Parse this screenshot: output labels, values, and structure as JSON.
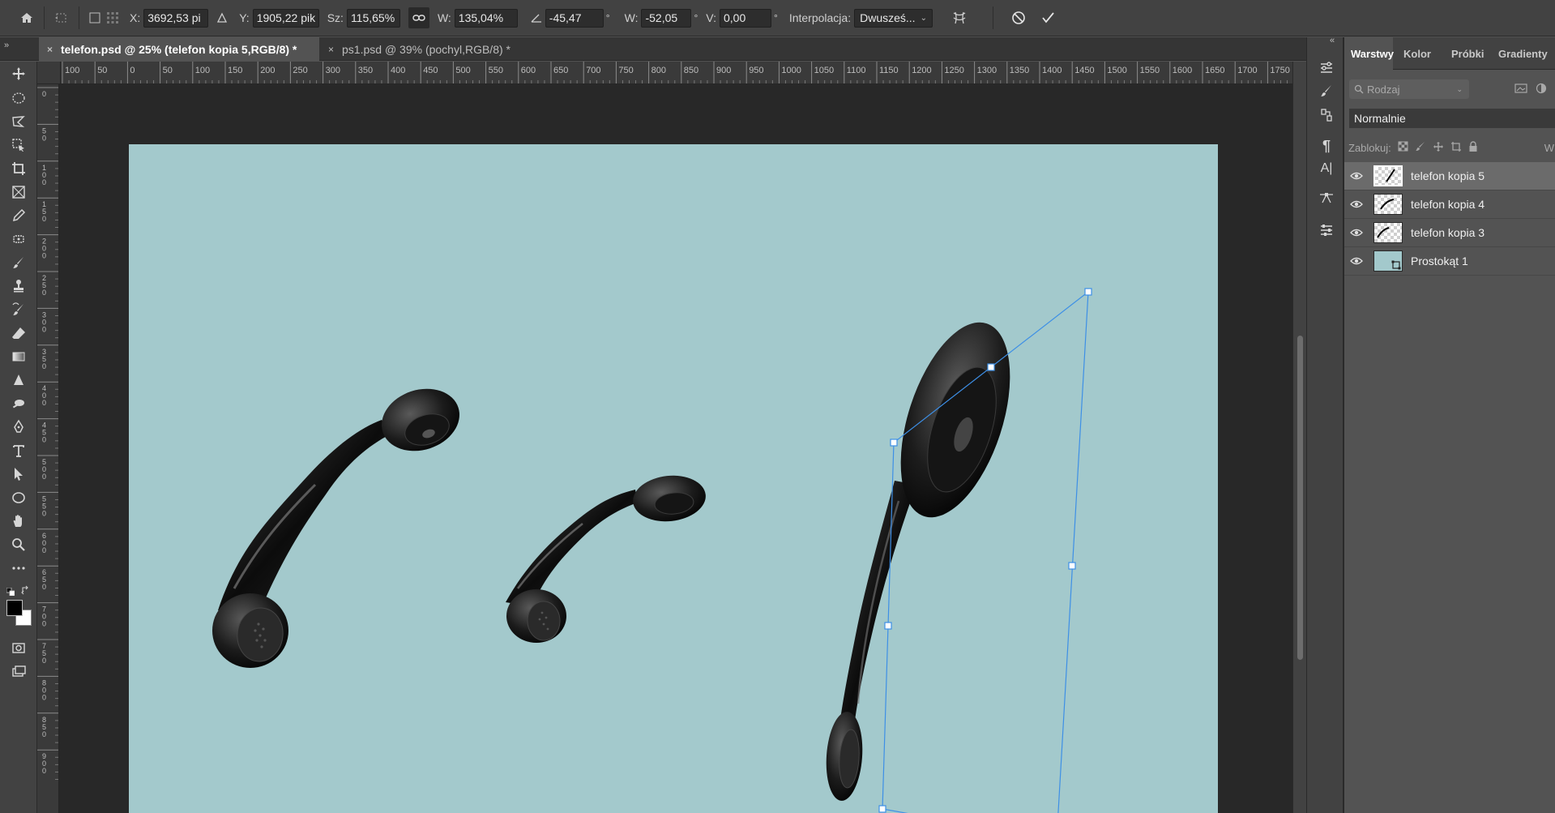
{
  "options_bar": {
    "icons": [
      "home-icon",
      "transform-reference-icon",
      "reference-point-checkbox",
      "reference-grid-icon"
    ],
    "x_label": "X:",
    "x_value": "3692,53 pi",
    "y_label": "Y:",
    "y_value": "1905,22 pik",
    "w_label": "Sz:",
    "w_value": "115,65%",
    "h_label": "W:",
    "h_value": "135,04%",
    "rotate_value": "-45,47",
    "degree_unit": "°",
    "skew_h_label": "W:",
    "skew_h_value": "-52,05",
    "skew_v_label": "V:",
    "skew_v_value": "0,00",
    "interpolation_label": "Interpolacja:",
    "interpolation_value": "Dwusześ..."
  },
  "tabs": [
    {
      "close": "×",
      "label": "telefon.psd @ 25% (telefon kopia 5,RGB/8) *",
      "active": true
    },
    {
      "close": "×",
      "label": "ps1.psd @ 39% (pochyl,RGB/8) *",
      "active": false
    }
  ],
  "rulers": {
    "top_ticks": [
      "100",
      "50",
      "0",
      "50",
      "100",
      "150",
      "200",
      "250",
      "300",
      "350",
      "400",
      "450",
      "500",
      "550",
      "600",
      "650",
      "700",
      "750",
      "800",
      "850",
      "900",
      "950",
      "1000",
      "1050",
      "1100",
      "1150",
      "1200",
      "1250",
      "1300",
      "1350",
      "1400",
      "1450",
      "1500",
      "1550",
      "1600",
      "1650",
      "1700",
      "1750"
    ],
    "left_ticks": [
      "0",
      "50",
      "100",
      "150",
      "200",
      "250",
      "300",
      "350",
      "400",
      "450",
      "500",
      "550",
      "600",
      "650",
      "700",
      "750",
      "800",
      "850",
      "900"
    ]
  },
  "canvas": {
    "background_color": "#a3c9cc",
    "handle_color": "#3d8fe6"
  },
  "layers_panel": {
    "tabs": [
      "Warstwy",
      "Kolor",
      "Próbki",
      "Gradienty"
    ],
    "filter_placeholder": "Rodzaj",
    "blend_mode": "Normalnie",
    "lock_label": "Zablokuj:",
    "opacity_initial": "W",
    "layers": [
      {
        "name": "telefon kopia 5",
        "selected": true,
        "thumb": "transparent"
      },
      {
        "name": "telefon kopia 4",
        "selected": false,
        "thumb": "transparent"
      },
      {
        "name": "telefon kopia 3",
        "selected": false,
        "thumb": "transparent"
      },
      {
        "name": "Prostokąt 1",
        "selected": false,
        "thumb": "solid"
      }
    ]
  }
}
